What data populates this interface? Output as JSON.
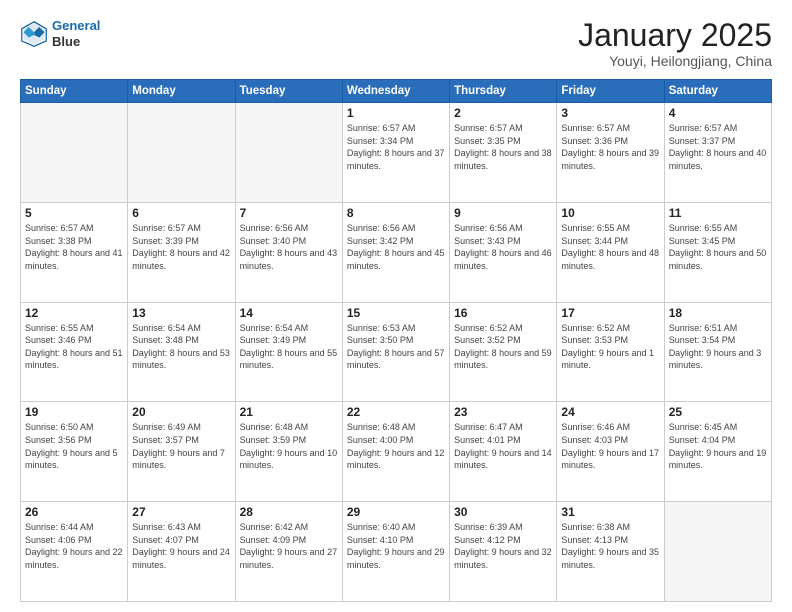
{
  "header": {
    "logo_line1": "General",
    "logo_line2": "Blue",
    "month_title": "January 2025",
    "location": "Youyi, Heilongjiang, China"
  },
  "weekdays": [
    "Sunday",
    "Monday",
    "Tuesday",
    "Wednesday",
    "Thursday",
    "Friday",
    "Saturday"
  ],
  "weeks": [
    [
      {
        "day": "",
        "info": "",
        "empty": true
      },
      {
        "day": "",
        "info": "",
        "empty": true
      },
      {
        "day": "",
        "info": "",
        "empty": true
      },
      {
        "day": "1",
        "info": "Sunrise: 6:57 AM\nSunset: 3:34 PM\nDaylight: 8 hours\nand 37 minutes."
      },
      {
        "day": "2",
        "info": "Sunrise: 6:57 AM\nSunset: 3:35 PM\nDaylight: 8 hours\nand 38 minutes."
      },
      {
        "day": "3",
        "info": "Sunrise: 6:57 AM\nSunset: 3:36 PM\nDaylight: 8 hours\nand 39 minutes."
      },
      {
        "day": "4",
        "info": "Sunrise: 6:57 AM\nSunset: 3:37 PM\nDaylight: 8 hours\nand 40 minutes."
      }
    ],
    [
      {
        "day": "5",
        "info": "Sunrise: 6:57 AM\nSunset: 3:38 PM\nDaylight: 8 hours\nand 41 minutes."
      },
      {
        "day": "6",
        "info": "Sunrise: 6:57 AM\nSunset: 3:39 PM\nDaylight: 8 hours\nand 42 minutes."
      },
      {
        "day": "7",
        "info": "Sunrise: 6:56 AM\nSunset: 3:40 PM\nDaylight: 8 hours\nand 43 minutes."
      },
      {
        "day": "8",
        "info": "Sunrise: 6:56 AM\nSunset: 3:42 PM\nDaylight: 8 hours\nand 45 minutes."
      },
      {
        "day": "9",
        "info": "Sunrise: 6:56 AM\nSunset: 3:43 PM\nDaylight: 8 hours\nand 46 minutes."
      },
      {
        "day": "10",
        "info": "Sunrise: 6:55 AM\nSunset: 3:44 PM\nDaylight: 8 hours\nand 48 minutes."
      },
      {
        "day": "11",
        "info": "Sunrise: 6:55 AM\nSunset: 3:45 PM\nDaylight: 8 hours\nand 50 minutes."
      }
    ],
    [
      {
        "day": "12",
        "info": "Sunrise: 6:55 AM\nSunset: 3:46 PM\nDaylight: 8 hours\nand 51 minutes."
      },
      {
        "day": "13",
        "info": "Sunrise: 6:54 AM\nSunset: 3:48 PM\nDaylight: 8 hours\nand 53 minutes."
      },
      {
        "day": "14",
        "info": "Sunrise: 6:54 AM\nSunset: 3:49 PM\nDaylight: 8 hours\nand 55 minutes."
      },
      {
        "day": "15",
        "info": "Sunrise: 6:53 AM\nSunset: 3:50 PM\nDaylight: 8 hours\nand 57 minutes."
      },
      {
        "day": "16",
        "info": "Sunrise: 6:52 AM\nSunset: 3:52 PM\nDaylight: 8 hours\nand 59 minutes."
      },
      {
        "day": "17",
        "info": "Sunrise: 6:52 AM\nSunset: 3:53 PM\nDaylight: 9 hours\nand 1 minute."
      },
      {
        "day": "18",
        "info": "Sunrise: 6:51 AM\nSunset: 3:54 PM\nDaylight: 9 hours\nand 3 minutes."
      }
    ],
    [
      {
        "day": "19",
        "info": "Sunrise: 6:50 AM\nSunset: 3:56 PM\nDaylight: 9 hours\nand 5 minutes."
      },
      {
        "day": "20",
        "info": "Sunrise: 6:49 AM\nSunset: 3:57 PM\nDaylight: 9 hours\nand 7 minutes."
      },
      {
        "day": "21",
        "info": "Sunrise: 6:48 AM\nSunset: 3:59 PM\nDaylight: 9 hours\nand 10 minutes."
      },
      {
        "day": "22",
        "info": "Sunrise: 6:48 AM\nSunset: 4:00 PM\nDaylight: 9 hours\nand 12 minutes."
      },
      {
        "day": "23",
        "info": "Sunrise: 6:47 AM\nSunset: 4:01 PM\nDaylight: 9 hours\nand 14 minutes."
      },
      {
        "day": "24",
        "info": "Sunrise: 6:46 AM\nSunset: 4:03 PM\nDaylight: 9 hours\nand 17 minutes."
      },
      {
        "day": "25",
        "info": "Sunrise: 6:45 AM\nSunset: 4:04 PM\nDaylight: 9 hours\nand 19 minutes."
      }
    ],
    [
      {
        "day": "26",
        "info": "Sunrise: 6:44 AM\nSunset: 4:06 PM\nDaylight: 9 hours\nand 22 minutes."
      },
      {
        "day": "27",
        "info": "Sunrise: 6:43 AM\nSunset: 4:07 PM\nDaylight: 9 hours\nand 24 minutes."
      },
      {
        "day": "28",
        "info": "Sunrise: 6:42 AM\nSunset: 4:09 PM\nDaylight: 9 hours\nand 27 minutes."
      },
      {
        "day": "29",
        "info": "Sunrise: 6:40 AM\nSunset: 4:10 PM\nDaylight: 9 hours\nand 29 minutes."
      },
      {
        "day": "30",
        "info": "Sunrise: 6:39 AM\nSunset: 4:12 PM\nDaylight: 9 hours\nand 32 minutes."
      },
      {
        "day": "31",
        "info": "Sunrise: 6:38 AM\nSunset: 4:13 PM\nDaylight: 9 hours\nand 35 minutes."
      },
      {
        "day": "",
        "info": "",
        "empty": true
      }
    ]
  ]
}
